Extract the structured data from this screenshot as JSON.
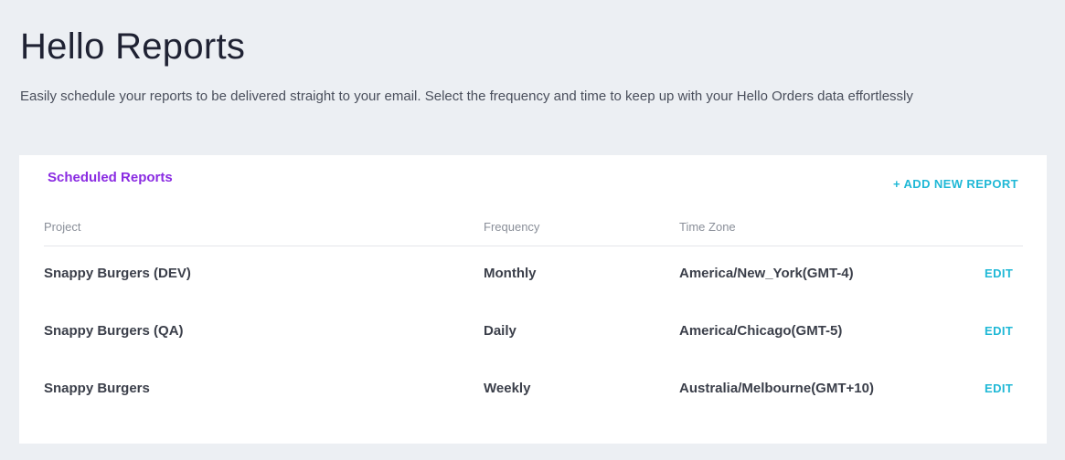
{
  "header": {
    "title": "Hello Reports",
    "subtitle": "Easily schedule your reports to be delivered straight to your email. Select the frequency and time to keep up with your Hello Orders data effortlessly"
  },
  "card": {
    "title": "Scheduled Reports",
    "add_button_label": "+ ADD NEW REPORT",
    "columns": {
      "project": "Project",
      "frequency": "Frequency",
      "timezone": "Time Zone"
    },
    "rows": [
      {
        "project": "Snappy Burgers (DEV)",
        "frequency": "Monthly",
        "timezone": "America/New_York(GMT-4)",
        "action": "EDIT"
      },
      {
        "project": "Snappy Burgers (QA)",
        "frequency": "Daily",
        "timezone": "America/Chicago(GMT-5)",
        "action": "EDIT"
      },
      {
        "project": "Snappy Burgers",
        "frequency": "Weekly",
        "timezone": "Australia/Melbourne(GMT+10)",
        "action": "EDIT"
      }
    ]
  },
  "colors": {
    "background": "#eceff3",
    "accent_purple": "#8a2be2",
    "accent_cyan": "#1fb8d6"
  }
}
